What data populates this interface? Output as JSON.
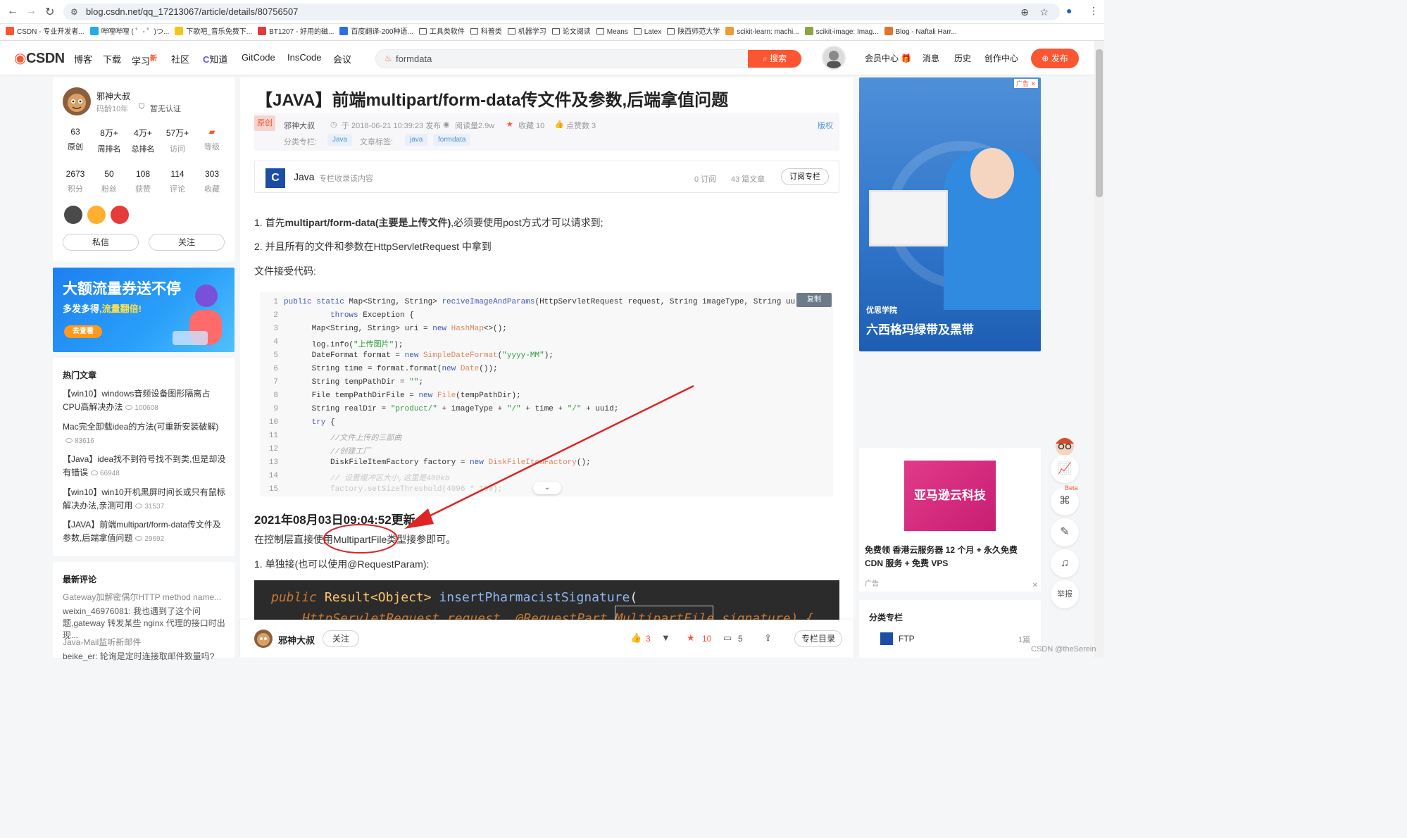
{
  "browser": {
    "url": "blog.csdn.net/qq_17213067/article/details/80756507",
    "bookmarks": [
      {
        "label": "CSDN - 专业开发者...",
        "color": "#fc5531"
      },
      {
        "label": "哔哩哔哩 ( ゜- ゜)つ...",
        "color": "#23ade5"
      },
      {
        "label": "下歌吧_音乐免费下...",
        "color": "#f5c518"
      },
      {
        "label": "BT1207 - 好用的磁...",
        "color": "#e23a3a"
      },
      {
        "label": "百度翻译-200种语...",
        "color": "#2f6ee2"
      },
      {
        "label": "工具类软件",
        "folder": true
      },
      {
        "label": "科普类",
        "folder": true
      },
      {
        "label": "机器学习",
        "folder": true
      },
      {
        "label": "论文阅读",
        "folder": true
      },
      {
        "label": "Means",
        "folder": true
      },
      {
        "label": "Latex",
        "folder": true
      },
      {
        "label": "陕西师范大学",
        "folder": true
      },
      {
        "label": "scikit-learn: machi...",
        "color": "#f09937"
      },
      {
        "label": "scikit-image: Imag...",
        "color": "#8aa63c"
      },
      {
        "label": "Blog - Naftali Harr...",
        "color": "#e5732a"
      }
    ]
  },
  "header": {
    "logo": "CSDN",
    "nav": [
      "博客",
      "下载",
      "学习",
      "社区",
      "知道",
      "GitCode",
      "InsCode",
      "会议"
    ],
    "new_badge": "新",
    "search_value": "formdata",
    "search_btn": "搜索",
    "right_nav": [
      "会员中心",
      "消息",
      "历史",
      "创作中心"
    ],
    "publish": "发布"
  },
  "profile": {
    "name": "邪神大叔",
    "age": "码龄10年",
    "cert": "暂无认证",
    "stats_row1": [
      {
        "v": "63",
        "l": "原创"
      },
      {
        "v": "8万+",
        "l": "周排名"
      },
      {
        "v": "4万+",
        "l": "总排名"
      },
      {
        "v": "57万+",
        "l": "访问"
      },
      {
        "v": "",
        "l": "等级"
      }
    ],
    "stats_row2": [
      {
        "v": "2673",
        "l": "积分"
      },
      {
        "v": "50",
        "l": "粉丝"
      },
      {
        "v": "108",
        "l": "获赞"
      },
      {
        "v": "114",
        "l": "评论"
      },
      {
        "v": "303",
        "l": "收藏"
      }
    ],
    "btn_msg": "私信",
    "btn_follow": "关注"
  },
  "ad_left": {
    "line1": "大额流量券送不停",
    "line2a": "多发多得,",
    "line2b": "流量翻倍!",
    "cta": "去查看"
  },
  "hot": {
    "title": "热门文章",
    "items": [
      {
        "text": "【win10】windows音频设备图形隔离占CPU高解决办法",
        "views": "100608"
      },
      {
        "text": "Mac完全卸载idea的方法(可重新安装破解)",
        "views": "83616"
      },
      {
        "text": "【Java】idea找不到符号找不到类,但是却没有错误",
        "views": "66948"
      },
      {
        "text": "【win10】win10开机黑屏时间长或只有鼠标解决办法,亲测可用",
        "views": "31537"
      },
      {
        "text": "【JAVA】前端multipart/form-data传文件及参数,后端拿值问题",
        "views": "29692"
      }
    ]
  },
  "comments": {
    "title": "最新评论",
    "items": [
      "Gateway加解密偶尔HTTP method name...",
      "weixin_46976081: 我也遇到了这个问题,gateway 转发某些 nginx 代理的接口时出现...",
      "Java-Mail监听新邮件",
      "beike_er: 轮询是定时连接取邮件数量吗?"
    ]
  },
  "article": {
    "title": "【JAVA】前端multipart/form-data传文件及参数,后端拿值问题",
    "orig": "原创",
    "author": "邪神大叔",
    "date": "于 2018-06-21 10:39:23 发布",
    "reads": "阅读量2.9w",
    "favs": "收藏 10",
    "likes": "点赞数 3",
    "copyright": "版权",
    "col_label": "分类专栏:",
    "col_tag": "Java",
    "tag_label": "文章标签:",
    "tags": [
      "java",
      "formdata"
    ],
    "column": {
      "icon": "C",
      "name": "Java",
      "desc": "专栏收录该内容",
      "subs": "0 订阅",
      "count": "43 篇文章",
      "btn": "订阅专栏"
    },
    "p1_a": "1. 首先",
    "p1_b": "multipart/form-data(主要是上传文件)",
    "p1_c": ",必须要使用post方式才可以请求到;",
    "p2": "2. 并且所有的文件和参数在HttpServletRequest 中拿到",
    "p3": "文件接受代码:",
    "copy": "复制",
    "code_lines": [
      "public static Map<String, String> reciveImageAndParams(HttpServletRequest request, String imageType, String uu",
      "          throws Exception {",
      "      Map<String, String> uri = new HashMap<>();",
      "      log.info(\"上传图片\");",
      "      DateFormat format = new SimpleDateFormat(\"yyyy-MM\");",
      "      String time = format.format(new Date());",
      "      String tempPathDir = \"\";",
      "      File tempPathDirFile = new File(tempPathDir);",
      "      String realDir = \"product/\" + imageType + \"/\" + time + \"/\" + uuid;",
      "      try {",
      "          //文件上传的三部曲",
      "          //创建工厂",
      "          DiskFileItemFactory factory = new DiskFileItemFactory();",
      "          // 设置缓冲区大小,这里是400kb",
      "          factory.setSizeThreshold(4096 * 100);"
    ],
    "update_head": "2021年08月03日09:04:52更新",
    "update_text": "在控制层直接使用MultipartFile类型接参即可。",
    "p4": "1. 单独接(也可以使用@RequestParam):",
    "dark_line1": "public Result<Object> insertPharmacistSignature(",
    "dark_line2": "HttpServletRequest request, @RequestPart MultipartFile signature) {"
  },
  "bottom": {
    "author": "邪神大叔",
    "follow": "关注",
    "likes": "3",
    "favs": "10",
    "comments": "5",
    "toc": "专栏目录"
  },
  "ad_right": {
    "tag": "广告",
    "brand": "优思学院",
    "slogan": "六西格玛绿带及黑带"
  },
  "ad2": {
    "img_text": "亚马逊云科技",
    "text": "免费领 香港云服务器 12 个月 + 永久免费 CDN 服务 + 免费 VPS",
    "adlabel": "广告"
  },
  "categories": {
    "title": "分类专栏",
    "name": "FTP",
    "count": "1篇"
  },
  "float_tools": {
    "beta": "Beta",
    "report": "举报"
  },
  "watermark": "CSDN @theSerein",
  "colors": {
    "brand": "#fc5531",
    "annotation": "#e02424"
  }
}
